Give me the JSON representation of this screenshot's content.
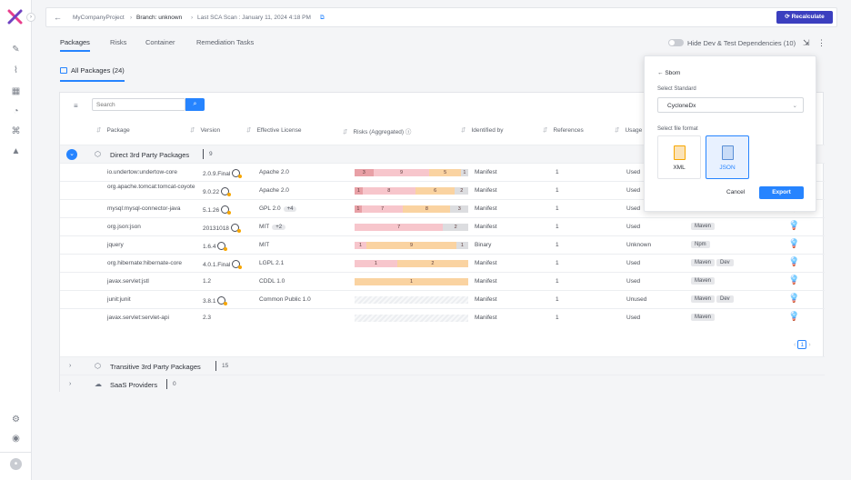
{
  "topbar": {
    "project": "MyCompanyProject",
    "branch": "Branch: unknown",
    "last_scan": "Last SCA Scan : January 11, 2024 4:18 PM",
    "recalculate": "Recalculate"
  },
  "tabs": [
    "Packages",
    "Risks",
    "Container",
    "Remediation Tasks"
  ],
  "hide_dev_label": "Hide Dev & Test Dependencies (10)",
  "subtab": "All Packages (24)",
  "search_placeholder": "Search",
  "columns": {
    "package": "Package",
    "version": "Version",
    "license": "Effective License",
    "risks": "Risks (Aggregated)",
    "identified_by": "Identified by",
    "references": "References",
    "usage": "Usage"
  },
  "groups": {
    "direct": {
      "name": "Direct 3rd Party Packages",
      "count": "9"
    },
    "transitive": {
      "name": "Transitive 3rd Party Packages",
      "count": "15"
    },
    "saas": {
      "name": "SaaS Providers",
      "count": "0"
    }
  },
  "rows": [
    {
      "package": "io.undertow:undertow-core",
      "version": "2.0.9.Final",
      "clock": true,
      "license": "Apache 2.0",
      "license_extra": "",
      "risks": {
        "critical": 3,
        "high": 9,
        "medium": 5,
        "low": 1
      },
      "identified_by": "Manifest",
      "references": "1",
      "usage": "Used",
      "tags": []
    },
    {
      "package": "org.apache.tomcat:tomcat-coyote",
      "version": "9.0.22",
      "clock": true,
      "license": "Apache 2.0",
      "license_extra": "",
      "risks": {
        "critical": 1,
        "high": 8,
        "medium": 6,
        "low": 2
      },
      "identified_by": "Manifest",
      "references": "1",
      "usage": "Used",
      "tags": []
    },
    {
      "package": "mysql:mysql-connector-java",
      "version": "5.1.26",
      "clock": true,
      "license": "GPL 2.0",
      "license_extra": "+4",
      "risks": {
        "critical": 1,
        "high": 7,
        "medium": 8,
        "low": 3
      },
      "identified_by": "Manifest",
      "references": "1",
      "usage": "Used",
      "tags": [
        "Maven"
      ]
    },
    {
      "package": "org.json:json",
      "version": "20131018",
      "clock": true,
      "license": "MIT",
      "license_extra": "+2",
      "risks": {
        "critical": 0,
        "high": 7,
        "medium": 0,
        "low": 2
      },
      "identified_by": "Manifest",
      "references": "1",
      "usage": "Used",
      "tags": [
        "Maven"
      ]
    },
    {
      "package": "jquery",
      "version": "1.6.4",
      "clock": true,
      "license": "MIT",
      "license_extra": "",
      "risks": {
        "critical": 0,
        "high": 1,
        "medium": 9,
        "low": 1
      },
      "identified_by": "Binary",
      "references": "1",
      "usage": "Unknown",
      "tags": [
        "Npm"
      ]
    },
    {
      "package": "org.hibernate:hibernate-core",
      "version": "4.0.1.Final",
      "clock": true,
      "license": "LGPL 2.1",
      "license_extra": "",
      "risks": {
        "critical": 0,
        "high": 1,
        "medium": 2,
        "low": 0
      },
      "identified_by": "Manifest",
      "references": "1",
      "usage": "Used",
      "tags": [
        "Maven",
        "Dev"
      ]
    },
    {
      "package": "javax.servlet:jstl",
      "version": "1.2",
      "clock": false,
      "license": "CDDL 1.0",
      "license_extra": "",
      "risks": {
        "critical": 0,
        "high": 0,
        "medium": 1,
        "low": 0
      },
      "identified_by": "Manifest",
      "references": "1",
      "usage": "Used",
      "tags": [
        "Maven"
      ]
    },
    {
      "package": "junit:junit",
      "version": "3.8.1",
      "clock": true,
      "license": "Common Public 1.0",
      "license_extra": "",
      "risks": {
        "critical": 0,
        "high": 0,
        "medium": 0,
        "low": 0
      },
      "identified_by": "Manifest",
      "references": "1",
      "usage": "Unused",
      "tags": [
        "Maven",
        "Dev"
      ]
    },
    {
      "package": "javax.servlet:servlet-api",
      "version": "2.3",
      "clock": false,
      "license": "",
      "license_extra": "",
      "risks": {
        "critical": 0,
        "high": 0,
        "medium": 0,
        "low": 0
      },
      "identified_by": "Manifest",
      "references": "1",
      "usage": "Used",
      "tags": [
        "Maven"
      ]
    }
  ],
  "pagination": {
    "current": "1"
  },
  "sbom_popup": {
    "title": "Sbom",
    "standard_label": "Select Standard",
    "standard_value": "CycloneDx",
    "format_label": "Select file format",
    "formats": [
      "XML",
      "JSON"
    ],
    "selected_format": "JSON",
    "cancel": "Cancel",
    "export": "Export"
  },
  "colors": {
    "accent": "#2684ff",
    "recalc": "#3b3fbf",
    "critical": "#e8a0a6",
    "high": "#f7c6cc",
    "medium": "#fad3a1",
    "low": "#dcdde0"
  }
}
